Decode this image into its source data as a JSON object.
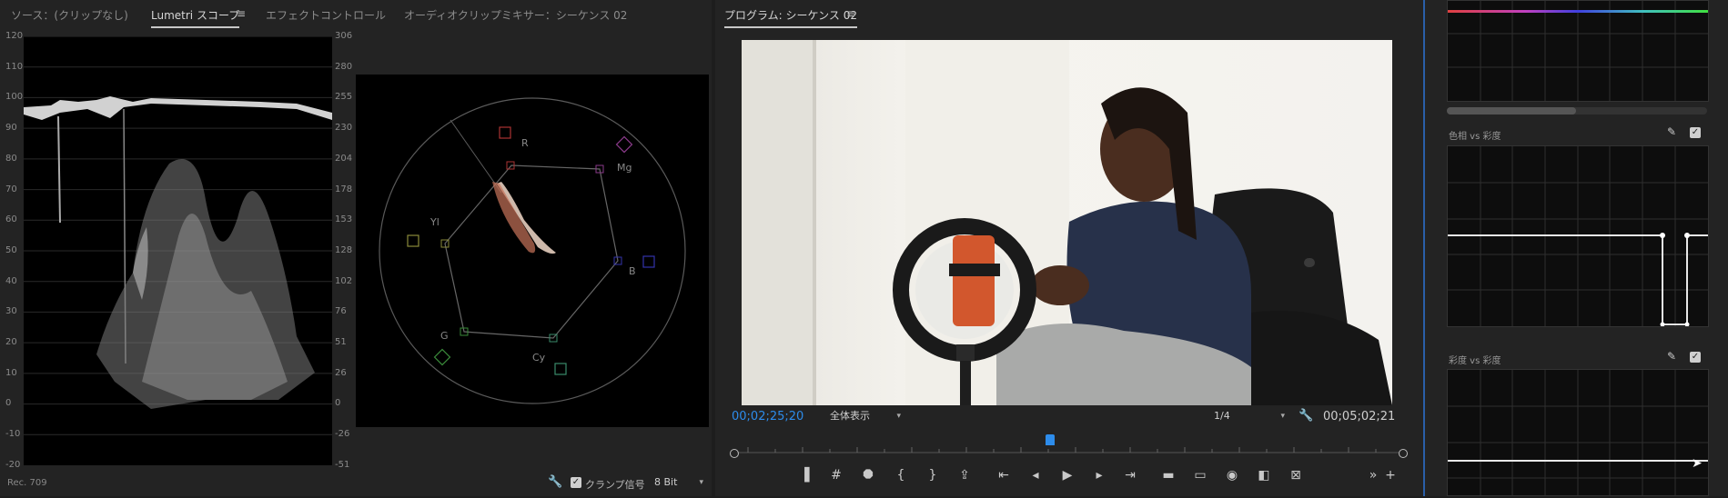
{
  "left_panel": {
    "tabs": [
      {
        "label": "ソース：(クリップなし)"
      },
      {
        "label": "Lumetri スコープ"
      },
      {
        "label": "エフェクトコントロール"
      },
      {
        "label": "オーディオクリップミキサー：シーケンス 02"
      }
    ],
    "waveform_left_axis": [
      "120",
      "110",
      "100",
      "90",
      "80",
      "70",
      "60",
      "50",
      "40",
      "30",
      "20",
      "10",
      "0",
      "-10",
      "-20"
    ],
    "waveform_right_axis": [
      "306",
      "280",
      "255",
      "230",
      "204",
      "178",
      "153",
      "128",
      "102",
      "76",
      "51",
      "26",
      "0",
      "-26",
      "-51"
    ],
    "vectorscope_labels": {
      "r": "R",
      "mg": "Mg",
      "b": "B",
      "cy": "Cy",
      "g": "G",
      "yl": "Yl"
    },
    "footer": {
      "color_space": "Rec. 709",
      "clamp_label": "クランプ信号",
      "clamp_checked": true,
      "bit_depth": "8 Bit"
    }
  },
  "program_monitor": {
    "title": "プログラム: シーケンス 02",
    "timecode_current": "00;02;25;20",
    "zoom": "全体表示",
    "resolution": "1/4",
    "timecode_duration": "00;05;02;21",
    "playhead_progress": 0.473,
    "accent": "#2d8ceb"
  },
  "lumetri_curves": {
    "hue_vs_sat_label": "色相 vs 彩度",
    "sat_vs_sat_label": "彩度 vs 彩度",
    "checked": true
  }
}
